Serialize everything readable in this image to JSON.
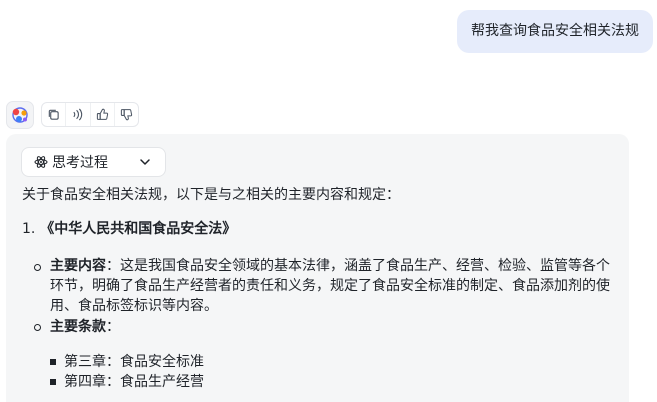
{
  "user_message": "帮我查询食品安全相关法规",
  "toolbar": {
    "buttons": [
      "copy-icon",
      "speaker-icon",
      "thumbs-up-icon",
      "thumbs-down-icon"
    ]
  },
  "thinking": {
    "label": "思考过程"
  },
  "answer": {
    "intro": "关于食品安全相关法规，以下是与之相关的主要内容和规定：",
    "law_number": "1.",
    "law_title": "《中华人民共和国食品安全法》",
    "content_key": "主要内容",
    "content_sep": "：",
    "content_text": "这是我国食品安全领域的基本法律，涵盖了食品生产、经营、检验、监管等各个环节，明确了食品生产经营者的责任和义务，规定了食品安全标准的制定、食品添加剂的使用、食品标签标识等内容。",
    "clauses_key": "主要条款",
    "clauses_sep": "：",
    "clauses": [
      "第三章：食品安全标准",
      "第四章：食品生产经营"
    ]
  }
}
